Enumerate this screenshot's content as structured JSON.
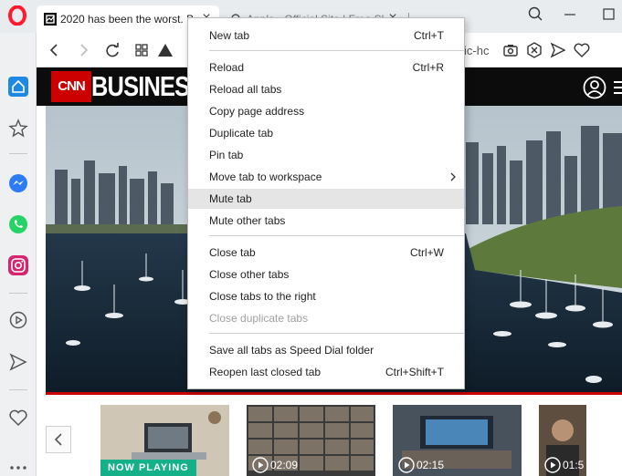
{
  "browser": {
    "tabs": [
      {
        "title": "2020 has been the worst. B",
        "active": true
      },
      {
        "title": "Apple - Official Site | Free Sh",
        "active": false
      }
    ],
    "address": {
      "url_fragment": "ic-hc"
    },
    "colors": {
      "opera_red": "#ff1b2d",
      "tabstrip": "#e9ecef",
      "sidebar": "#eef0f2"
    }
  },
  "sidebar": {
    "items": [
      {
        "icon": "home-icon"
      },
      {
        "icon": "star-icon"
      },
      {
        "icon": "messenger-icon"
      },
      {
        "icon": "whatsapp-icon"
      },
      {
        "icon": "instagram-icon"
      },
      {
        "icon": "player-icon"
      },
      {
        "icon": "send-icon"
      },
      {
        "icon": "heart-icon"
      },
      {
        "icon": "more-icon"
      }
    ]
  },
  "page": {
    "logo": {
      "cnn": "CNN",
      "section": "BUSINESS"
    },
    "video_strip": {
      "now_playing": "NOW PLAYING",
      "thumbs": [
        {
          "time": ""
        },
        {
          "time": "02:09"
        },
        {
          "time": "02:15"
        },
        {
          "time": "01:5"
        }
      ]
    }
  },
  "context_menu": {
    "items": [
      {
        "label": "New tab",
        "shortcut": "Ctrl+T"
      },
      {
        "label": "Reload",
        "shortcut": "Ctrl+R"
      },
      {
        "label": "Reload all tabs",
        "shortcut": ""
      },
      {
        "label": "Copy page address",
        "shortcut": ""
      },
      {
        "label": "Duplicate tab",
        "shortcut": ""
      },
      {
        "label": "Pin tab",
        "shortcut": ""
      },
      {
        "label": "Move tab to workspace",
        "shortcut": "",
        "submenu": true
      },
      {
        "label": "Mute tab",
        "shortcut": "",
        "hovered": true
      },
      {
        "label": "Mute other tabs",
        "shortcut": ""
      },
      {
        "label": "Close tab",
        "shortcut": "Ctrl+W"
      },
      {
        "label": "Close other tabs",
        "shortcut": ""
      },
      {
        "label": "Close tabs to the right",
        "shortcut": ""
      },
      {
        "label": "Close duplicate tabs",
        "shortcut": "",
        "disabled": true
      },
      {
        "label": "Save all tabs as Speed Dial folder",
        "shortcut": ""
      },
      {
        "label": "Reopen last closed tab",
        "shortcut": "Ctrl+Shift+T"
      }
    ]
  }
}
